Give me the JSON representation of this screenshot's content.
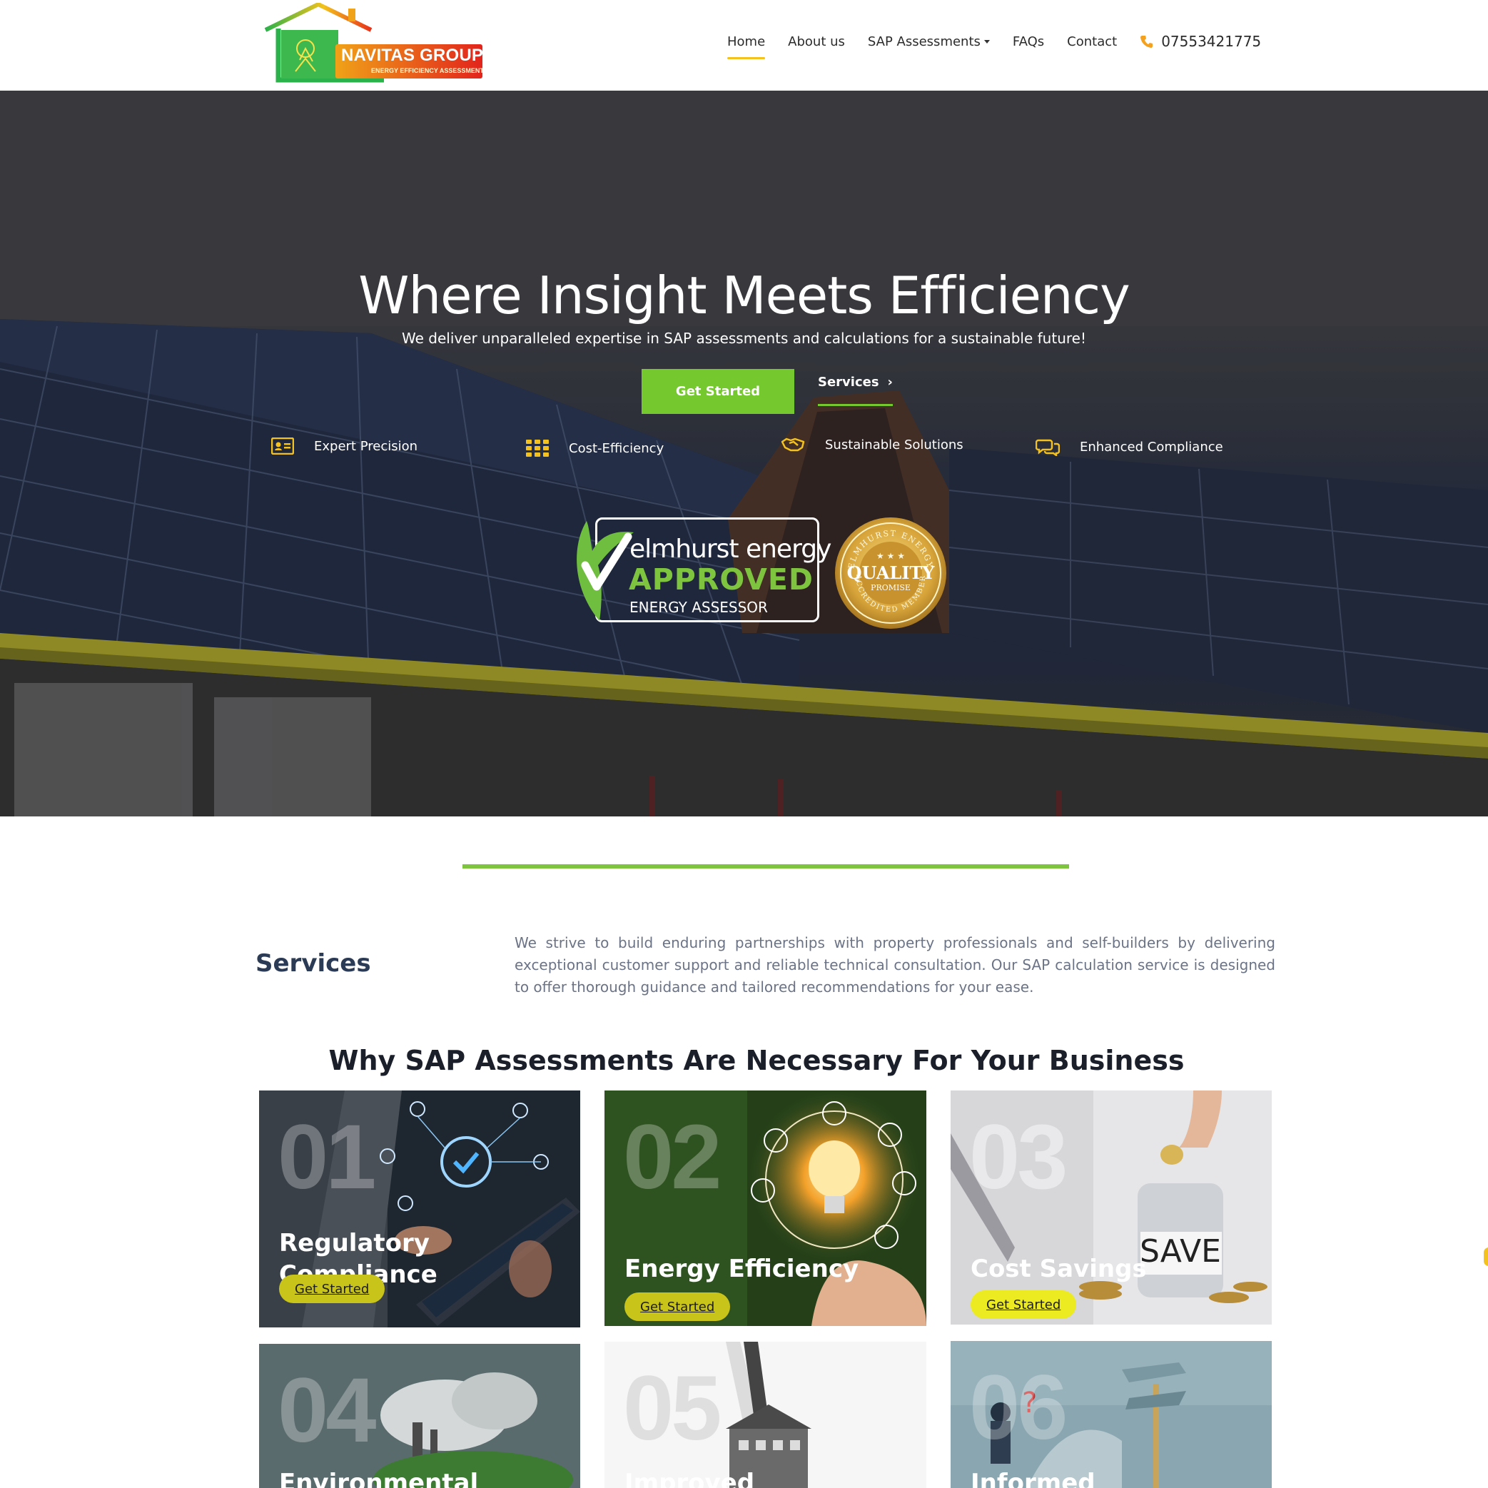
{
  "logo": {
    "title": "NAVITAS GROUP",
    "subtitle": "ENERGY EFFICIENCY ASSESSMENT"
  },
  "nav": {
    "items": [
      {
        "label": "Home",
        "active": true
      },
      {
        "label": "About us"
      },
      {
        "label": "SAP Assessments",
        "dropdown": true
      },
      {
        "label": "FAQs"
      },
      {
        "label": "Contact"
      }
    ],
    "phone": "07553421775",
    "phone_icon": "phone-icon"
  },
  "hero": {
    "title": "Where Insight Meets Efficiency",
    "subtitle": "We deliver unparalleled expertise in SAP assessments and calculations for a sustainable future!",
    "primary_button": "Get Started",
    "secondary_button": "Services",
    "features": [
      {
        "icon": "id-card-icon",
        "label": "Expert Precision"
      },
      {
        "icon": "grid-icon",
        "label": "Cost-Efficiency"
      },
      {
        "icon": "handshake-icon",
        "label": "Sustainable Solutions"
      },
      {
        "icon": "chat-bubbles-icon",
        "label": "Enhanced Compliance"
      }
    ],
    "badge_elmhurst": {
      "line1": "elmhurst energy",
      "line2": "APPROVED",
      "line3": "ENERGY ASSESSOR"
    },
    "badge_quality": {
      "arc_top": "ELMHURST ENERGY",
      "center": "QUALITY",
      "promise": "PROMISE",
      "arc_bottom": "ACCREDITED MEMBER"
    }
  },
  "services": {
    "heading": "Services",
    "text": "We strive to build enduring partnerships with property professionals and self-builders by delivering exceptional customer support and reliable technical consultation. Our SAP calculation service is designed to offer thorough guidance and tailored recommendations for your ease."
  },
  "why": {
    "heading": "Why SAP Assessments Are Necessary For Your Business",
    "cards": [
      {
        "num": "01",
        "title_l1": "Regulatory",
        "title_l2": "Compliance",
        "button": "Get Started"
      },
      {
        "num": "02",
        "title_l1": "Energy Efficiency",
        "title_l2": "",
        "button": "Get Started"
      },
      {
        "num": "03",
        "title_l1": "Cost Savings",
        "title_l2": "",
        "button": "Get Started"
      },
      {
        "num": "04",
        "title_l1": "Environmental",
        "title_l2": ""
      },
      {
        "num": "05",
        "title_l1": "Improved",
        "title_l2": ""
      },
      {
        "num": "06",
        "title_l1": "Informed",
        "title_l2": ""
      }
    ]
  },
  "colors": {
    "accent_green": "#76c82f",
    "accent_yellow": "#f4c21f",
    "heading_navy": "#2b3a55"
  }
}
